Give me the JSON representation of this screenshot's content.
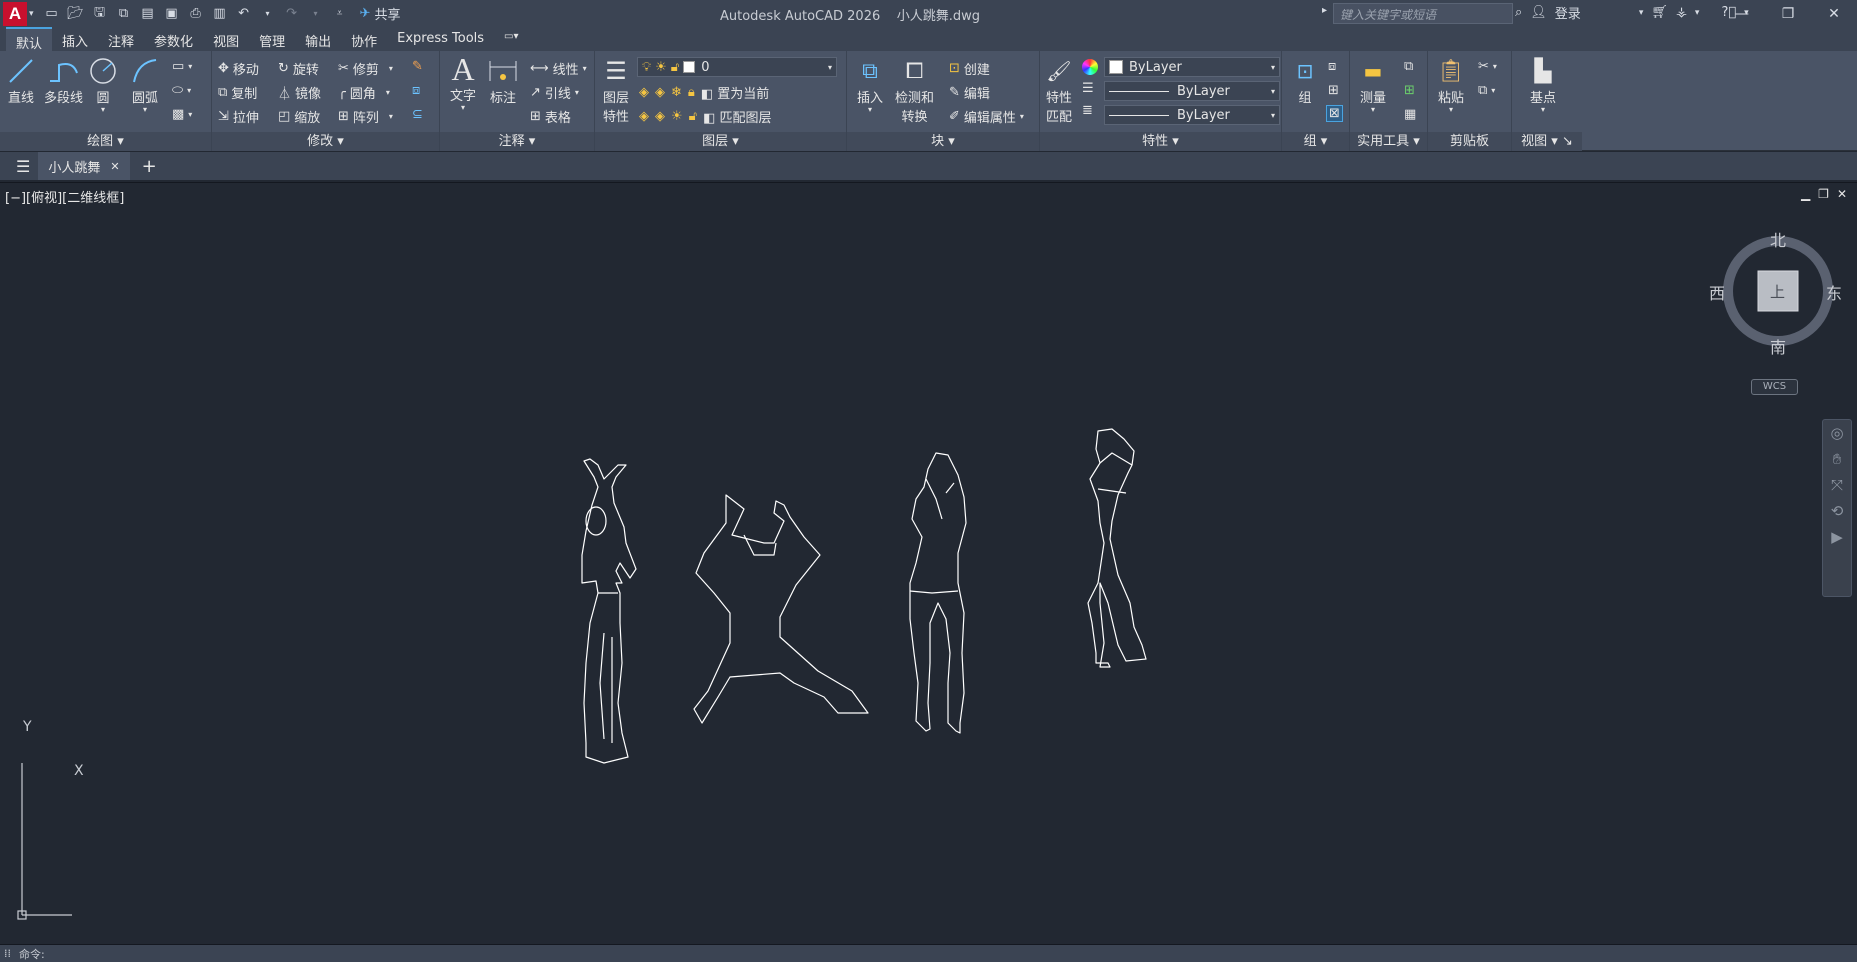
{
  "titlebar": {
    "logo": "A",
    "share": "共享",
    "app_title": "Autodesk AutoCAD 2026",
    "file_name": "小人跳舞.dwg",
    "search_placeholder": "键入关键字或短语",
    "login": "登录"
  },
  "tabs": [
    "默认",
    "插入",
    "注释",
    "参数化",
    "视图",
    "管理",
    "输出",
    "协作",
    "Express Tools"
  ],
  "ribbon": {
    "draw": {
      "label": "绘图",
      "line": "直线",
      "polyline": "多段线",
      "circle": "圆",
      "arc": "圆弧"
    },
    "modify": {
      "label": "修改",
      "move": "移动",
      "rotate": "旋转",
      "trim": "修剪",
      "copy": "复制",
      "mirror": "镜像",
      "fillet": "圆角",
      "stretch": "拉伸",
      "scale": "缩放",
      "array": "阵列"
    },
    "annotation": {
      "label": "注释",
      "text": "文字",
      "dimension": "标注",
      "linear": "线性",
      "leader": "引线",
      "table": "表格"
    },
    "layers": {
      "label": "图层",
      "layer_props_1": "图层",
      "layer_props_2": "特性",
      "current_layer": "0",
      "set_current": "置为当前",
      "match_layer": "匹配图层"
    },
    "block": {
      "label": "块",
      "insert": "插入",
      "detect_1": "检测和",
      "detect_2": "转换",
      "create": "创建",
      "edit": "编辑",
      "edit_attr": "编辑属性"
    },
    "properties": {
      "label": "特性",
      "match_1": "特性",
      "match_2": "匹配",
      "color": "ByLayer",
      "linetype": "ByLayer",
      "lineweight": "ByLayer"
    },
    "groups": {
      "label": "组",
      "group": "组"
    },
    "utilities": {
      "label": "实用工具",
      "measure": "测量"
    },
    "clipboard": {
      "label": "剪贴板",
      "paste": "粘贴"
    },
    "view": {
      "label": "视图",
      "base": "基点"
    }
  },
  "doc_tab": "小人跳舞",
  "viewport": {
    "label": "[−][俯视][二维线框]",
    "compass": {
      "north": "北",
      "south": "南",
      "east": "东",
      "west": "西",
      "face": "上"
    },
    "wcs": "WCS",
    "ucs_y": "Y",
    "ucs_x": "X"
  },
  "statusbar": {
    "command": "命令:"
  }
}
